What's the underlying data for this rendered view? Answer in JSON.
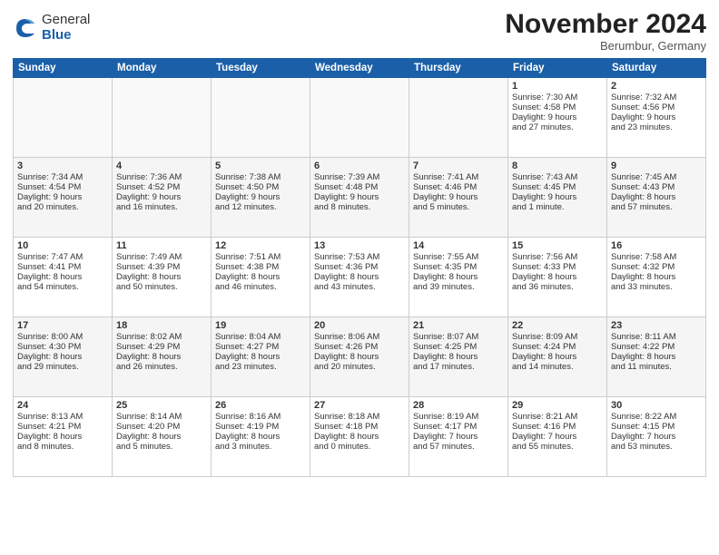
{
  "logo": {
    "general": "General",
    "blue": "Blue"
  },
  "header": {
    "month": "November 2024",
    "location": "Berumbur, Germany"
  },
  "weekdays": [
    "Sunday",
    "Monday",
    "Tuesday",
    "Wednesday",
    "Thursday",
    "Friday",
    "Saturday"
  ],
  "weeks": [
    [
      {
        "day": "",
        "info": ""
      },
      {
        "day": "",
        "info": ""
      },
      {
        "day": "",
        "info": ""
      },
      {
        "day": "",
        "info": ""
      },
      {
        "day": "",
        "info": ""
      },
      {
        "day": "1",
        "info": "Sunrise: 7:30 AM\nSunset: 4:58 PM\nDaylight: 9 hours\nand 27 minutes."
      },
      {
        "day": "2",
        "info": "Sunrise: 7:32 AM\nSunset: 4:56 PM\nDaylight: 9 hours\nand 23 minutes."
      }
    ],
    [
      {
        "day": "3",
        "info": "Sunrise: 7:34 AM\nSunset: 4:54 PM\nDaylight: 9 hours\nand 20 minutes."
      },
      {
        "day": "4",
        "info": "Sunrise: 7:36 AM\nSunset: 4:52 PM\nDaylight: 9 hours\nand 16 minutes."
      },
      {
        "day": "5",
        "info": "Sunrise: 7:38 AM\nSunset: 4:50 PM\nDaylight: 9 hours\nand 12 minutes."
      },
      {
        "day": "6",
        "info": "Sunrise: 7:39 AM\nSunset: 4:48 PM\nDaylight: 9 hours\nand 8 minutes."
      },
      {
        "day": "7",
        "info": "Sunrise: 7:41 AM\nSunset: 4:46 PM\nDaylight: 9 hours\nand 5 minutes."
      },
      {
        "day": "8",
        "info": "Sunrise: 7:43 AM\nSunset: 4:45 PM\nDaylight: 9 hours\nand 1 minute."
      },
      {
        "day": "9",
        "info": "Sunrise: 7:45 AM\nSunset: 4:43 PM\nDaylight: 8 hours\nand 57 minutes."
      }
    ],
    [
      {
        "day": "10",
        "info": "Sunrise: 7:47 AM\nSunset: 4:41 PM\nDaylight: 8 hours\nand 54 minutes."
      },
      {
        "day": "11",
        "info": "Sunrise: 7:49 AM\nSunset: 4:39 PM\nDaylight: 8 hours\nand 50 minutes."
      },
      {
        "day": "12",
        "info": "Sunrise: 7:51 AM\nSunset: 4:38 PM\nDaylight: 8 hours\nand 46 minutes."
      },
      {
        "day": "13",
        "info": "Sunrise: 7:53 AM\nSunset: 4:36 PM\nDaylight: 8 hours\nand 43 minutes."
      },
      {
        "day": "14",
        "info": "Sunrise: 7:55 AM\nSunset: 4:35 PM\nDaylight: 8 hours\nand 39 minutes."
      },
      {
        "day": "15",
        "info": "Sunrise: 7:56 AM\nSunset: 4:33 PM\nDaylight: 8 hours\nand 36 minutes."
      },
      {
        "day": "16",
        "info": "Sunrise: 7:58 AM\nSunset: 4:32 PM\nDaylight: 8 hours\nand 33 minutes."
      }
    ],
    [
      {
        "day": "17",
        "info": "Sunrise: 8:00 AM\nSunset: 4:30 PM\nDaylight: 8 hours\nand 29 minutes."
      },
      {
        "day": "18",
        "info": "Sunrise: 8:02 AM\nSunset: 4:29 PM\nDaylight: 8 hours\nand 26 minutes."
      },
      {
        "day": "19",
        "info": "Sunrise: 8:04 AM\nSunset: 4:27 PM\nDaylight: 8 hours\nand 23 minutes."
      },
      {
        "day": "20",
        "info": "Sunrise: 8:06 AM\nSunset: 4:26 PM\nDaylight: 8 hours\nand 20 minutes."
      },
      {
        "day": "21",
        "info": "Sunrise: 8:07 AM\nSunset: 4:25 PM\nDaylight: 8 hours\nand 17 minutes."
      },
      {
        "day": "22",
        "info": "Sunrise: 8:09 AM\nSunset: 4:24 PM\nDaylight: 8 hours\nand 14 minutes."
      },
      {
        "day": "23",
        "info": "Sunrise: 8:11 AM\nSunset: 4:22 PM\nDaylight: 8 hours\nand 11 minutes."
      }
    ],
    [
      {
        "day": "24",
        "info": "Sunrise: 8:13 AM\nSunset: 4:21 PM\nDaylight: 8 hours\nand 8 minutes."
      },
      {
        "day": "25",
        "info": "Sunrise: 8:14 AM\nSunset: 4:20 PM\nDaylight: 8 hours\nand 5 minutes."
      },
      {
        "day": "26",
        "info": "Sunrise: 8:16 AM\nSunset: 4:19 PM\nDaylight: 8 hours\nand 3 minutes."
      },
      {
        "day": "27",
        "info": "Sunrise: 8:18 AM\nSunset: 4:18 PM\nDaylight: 8 hours\nand 0 minutes."
      },
      {
        "day": "28",
        "info": "Sunrise: 8:19 AM\nSunset: 4:17 PM\nDaylight: 7 hours\nand 57 minutes."
      },
      {
        "day": "29",
        "info": "Sunrise: 8:21 AM\nSunset: 4:16 PM\nDaylight: 7 hours\nand 55 minutes."
      },
      {
        "day": "30",
        "info": "Sunrise: 8:22 AM\nSunset: 4:15 PM\nDaylight: 7 hours\nand 53 minutes."
      }
    ]
  ]
}
